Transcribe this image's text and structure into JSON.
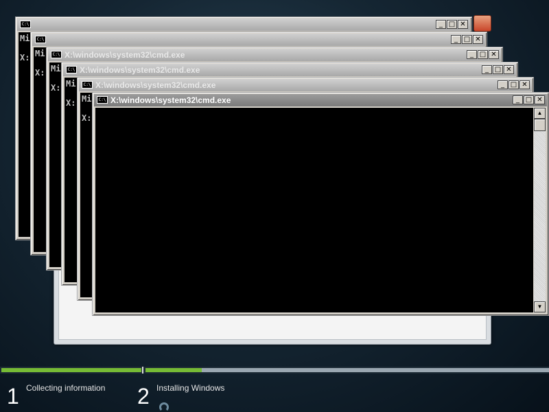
{
  "windows": [
    {
      "title": "",
      "text": "Mi\n\nX:",
      "active": false
    },
    {
      "title": "",
      "text": "Mi\n\nX:",
      "active": false
    },
    {
      "title": "X:\\windows\\system32\\cmd.exe",
      "text": "Mi\n\nX:",
      "active": false
    },
    {
      "title": "X:\\windows\\system32\\cmd.exe",
      "text": "Mi\n\nX:",
      "active": false
    },
    {
      "title": "X:\\windows\\system32\\cmd.exe",
      "text": "Mi\n\nX:",
      "active": false
    },
    {
      "title": "X:\\windows\\system32\\cmd.exe",
      "text": "",
      "active": true
    }
  ],
  "window_controls": {
    "minimize": "_",
    "maximize": "□",
    "close": "✕"
  },
  "scroll": {
    "up": "▲",
    "down": "▼"
  },
  "footer": {
    "steps": [
      {
        "number": "1",
        "label": "Collecting information"
      },
      {
        "number": "2",
        "label": "Installing Windows"
      }
    ],
    "progress": {
      "step1": 1.0,
      "step2": 0.14
    },
    "colors": {
      "complete": "#76bb35",
      "remaining": "#9aa7b1"
    }
  }
}
